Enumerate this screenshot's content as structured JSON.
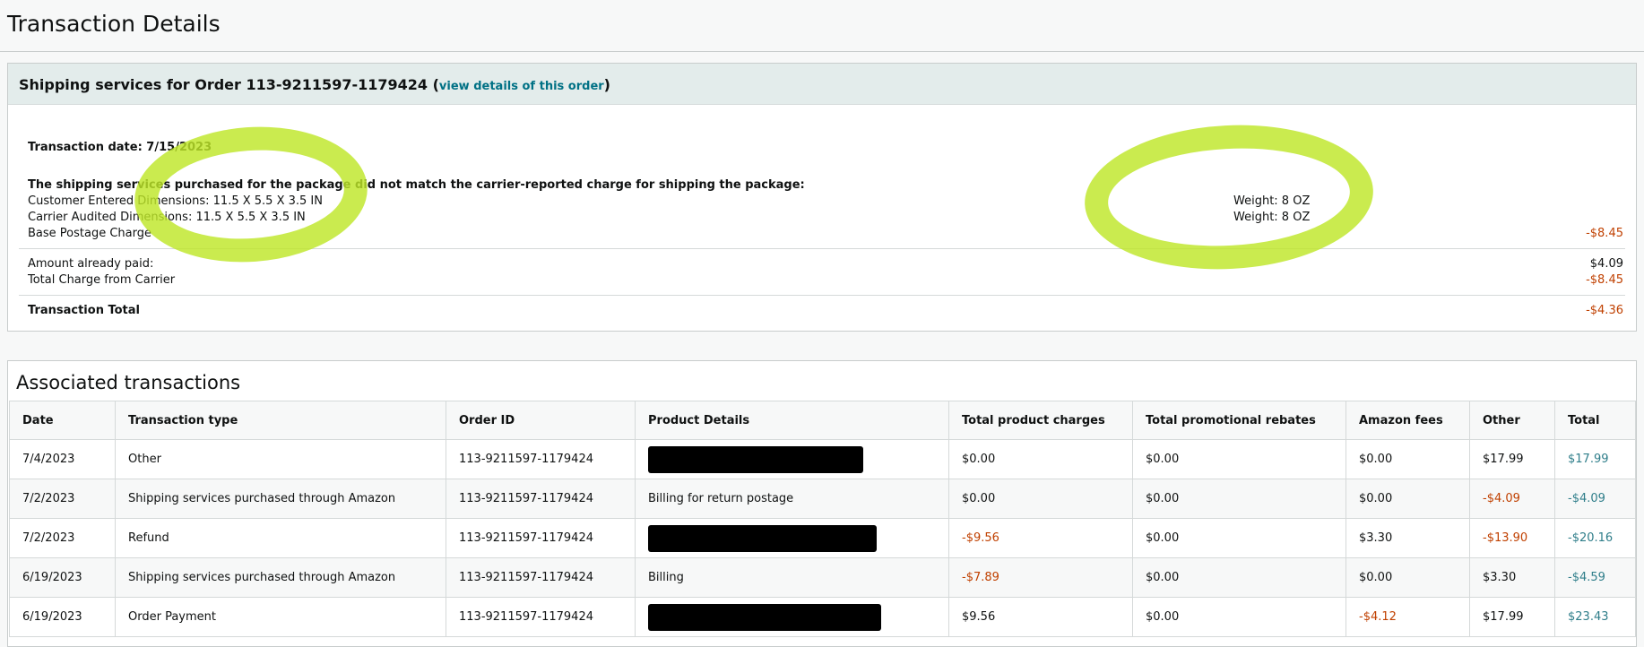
{
  "page_title": "Transaction Details",
  "shipping": {
    "heading": "Shipping services for Order 113-9211597-1179424",
    "paren_open": " (",
    "link_text": "view details of this order",
    "paren_close": ")",
    "transaction_date": "Transaction date: 7/15/2023",
    "mismatch_note": "The shipping services purchased for the package did not match the carrier-reported charge for shipping the package:",
    "customer_dims": "Customer Entered Dimensions: 11.5 X 5.5 X 3.5 IN",
    "carrier_dims": "Carrier Audited Dimensions: 11.5 X 5.5 X 3.5 IN",
    "customer_weight": "Weight: 8 OZ",
    "carrier_weight": "Weight: 8 OZ",
    "base_label": "Base Postage Charge",
    "base_amount": "-$8.45",
    "paid_label": "Amount already paid:",
    "paid_amount": "$4.09",
    "carrier_total_label": "Total Charge from Carrier",
    "carrier_total_amount": "-$8.45",
    "total_label": "Transaction Total",
    "total_amount": "-$4.36"
  },
  "associated": {
    "title": "Associated transactions",
    "columns": [
      "Date",
      "Transaction type",
      "Order ID",
      "Product Details",
      "Total product charges",
      "Total promotional rebates",
      "Amazon fees",
      "Other",
      "Total"
    ],
    "rows": [
      {
        "date": "7/4/2023",
        "type": "Other",
        "order_id": "113-9211597-1179424",
        "product": "",
        "product_charges": "$0.00",
        "rebates": "$0.00",
        "fees": "$0.00",
        "other": "$17.99",
        "total": "$17.99"
      },
      {
        "date": "7/2/2023",
        "type": "Shipping services purchased through Amazon",
        "order_id": "113-9211597-1179424",
        "product": "Billing for return postage",
        "product_charges": "$0.00",
        "rebates": "$0.00",
        "fees": "$0.00",
        "other": "-$4.09",
        "total": "-$4.09"
      },
      {
        "date": "7/2/2023",
        "type": "Refund",
        "order_id": "113-9211597-1179424",
        "product": "",
        "product_charges": "-$9.56",
        "rebates": "$0.00",
        "fees": "$3.30",
        "other": "-$13.90",
        "total": "-$20.16"
      },
      {
        "date": "6/19/2023",
        "type": "Shipping services purchased through Amazon",
        "order_id": "113-9211597-1179424",
        "product": "Billing",
        "product_charges": "-$7.89",
        "rebates": "$0.00",
        "fees": "$0.00",
        "other": "$3.30",
        "total": "-$4.59"
      },
      {
        "date": "6/19/2023",
        "type": "Order Payment",
        "order_id": "113-9211597-1179424",
        "product": "",
        "product_charges": "$9.56",
        "rebates": "$0.00",
        "fees": "-$4.12",
        "other": "$17.99",
        "total": "$23.43"
      }
    ]
  },
  "colors": {
    "negative": "#c04000",
    "link": "#007185",
    "highlight": "#c6ea3c"
  }
}
